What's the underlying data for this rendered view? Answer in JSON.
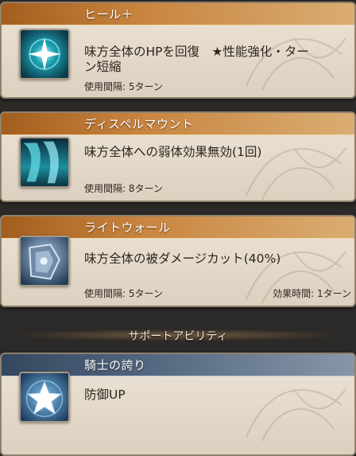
{
  "skills": [
    {
      "title": "ヒール＋",
      "desc_line1": "味方全体のHPを回復　★性能強化・ター",
      "desc_line2": "ン短縮",
      "cooldown": "使用間隔: 5ターン",
      "icon": "sparkle-heal-icon",
      "accent": "#c98540"
    },
    {
      "title": "ディスペルマウント",
      "desc_line1": "味方全体への弱体効果無効(1回)",
      "cooldown": "使用間隔: 8ターン",
      "icon": "dispel-mount-icon",
      "accent": "#c98540"
    },
    {
      "title": "ライトウォール",
      "desc_line1": "味方全体の被ダメージカット(40%)",
      "cooldown": "使用間隔: 5ターン",
      "duration": "効果時間: 1ターン",
      "icon": "knight-shield-icon",
      "accent": "#c98540"
    }
  ],
  "support_header": "サポートアビリティ",
  "support": {
    "title": "騎士の誇り",
    "desc": "防御UP",
    "icon": "star-icon",
    "accent": "#52657e"
  }
}
